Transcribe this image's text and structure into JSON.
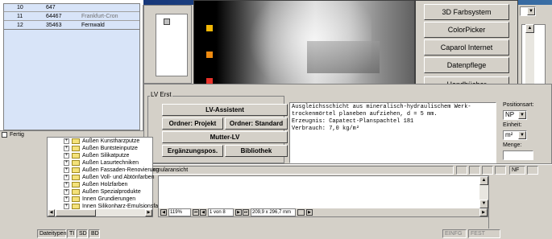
{
  "top_list": {
    "rows": [
      {
        "num": "10",
        "code": "647",
        "name": ""
      },
      {
        "num": "11",
        "code": "64467",
        "name": "Frankfurt-Cron"
      },
      {
        "num": "12",
        "code": "35463",
        "name": "Fernwald"
      }
    ]
  },
  "small_status": {
    "label": "Fertig"
  },
  "splash": {
    "buttons": [
      {
        "label": "3D Farbsystem",
        "accel": "3"
      },
      {
        "label": "ColorPicker",
        "accel": "C"
      },
      {
        "label": "Caparol Internet",
        "accel": "I"
      },
      {
        "label": "Datenpflege",
        "accel": "p"
      },
      {
        "label": "Handbücher",
        "accel": "H"
      }
    ],
    "dots": [
      "#f2b705",
      "#ee8a10",
      "#e8322a"
    ]
  },
  "lv_panel": {
    "group_label": "LV Erst",
    "buttons": {
      "assistant": "LV-Assistent",
      "ordner_projekt": "Ordner: Projekt",
      "ordner_standard": "Ordner: Standard",
      "mutter_lv": "Mutter-LV",
      "ergaenzung": "Ergänzungspos.",
      "bibliothek": "Bibliothek"
    },
    "text_lines": [
      "Ausgleichsschicht aus mineralisch-hydraulischem Werk-",
      "trockenmörtel planeben aufziehen, d = 5 mm.",
      "Erzeugnis: Capatect-Planspachtel 181",
      "Verbrauch: 7,0 kg/m²"
    ],
    "positionsart_label": "Positionsart:",
    "positionsart_value": "NP",
    "einheit_label": "Einheit:",
    "einheit_value": "m²",
    "menge_label": "Menge:",
    "menge_value": ""
  },
  "form_status": {
    "label": "Formularansicht",
    "nf": "NF"
  },
  "tree": {
    "items": [
      "Außen Kunstharzputze",
      "Außen Buntsteinputze",
      "Außen Silikatputze",
      "Außen Lasurtechniken",
      "Außen Fassaden-Renovierung",
      "Außen Voll- und Abtönfarben",
      "Außen Holzfarben",
      "Außen Spezialprodukte",
      "Innen Grundierungen",
      "Innen Silikonharz-Emulsionsfarb..."
    ]
  },
  "pdf_nav": {
    "zoom": "119%",
    "page": "1 von 8",
    "size": "209,9 x 296,7 mm"
  },
  "bottom_bar": {
    "dateitypen": "Dateitypen",
    "tabs": [
      "TI",
      "SD",
      "BD"
    ],
    "einfg": "EINFG",
    "fest": "FEST"
  }
}
